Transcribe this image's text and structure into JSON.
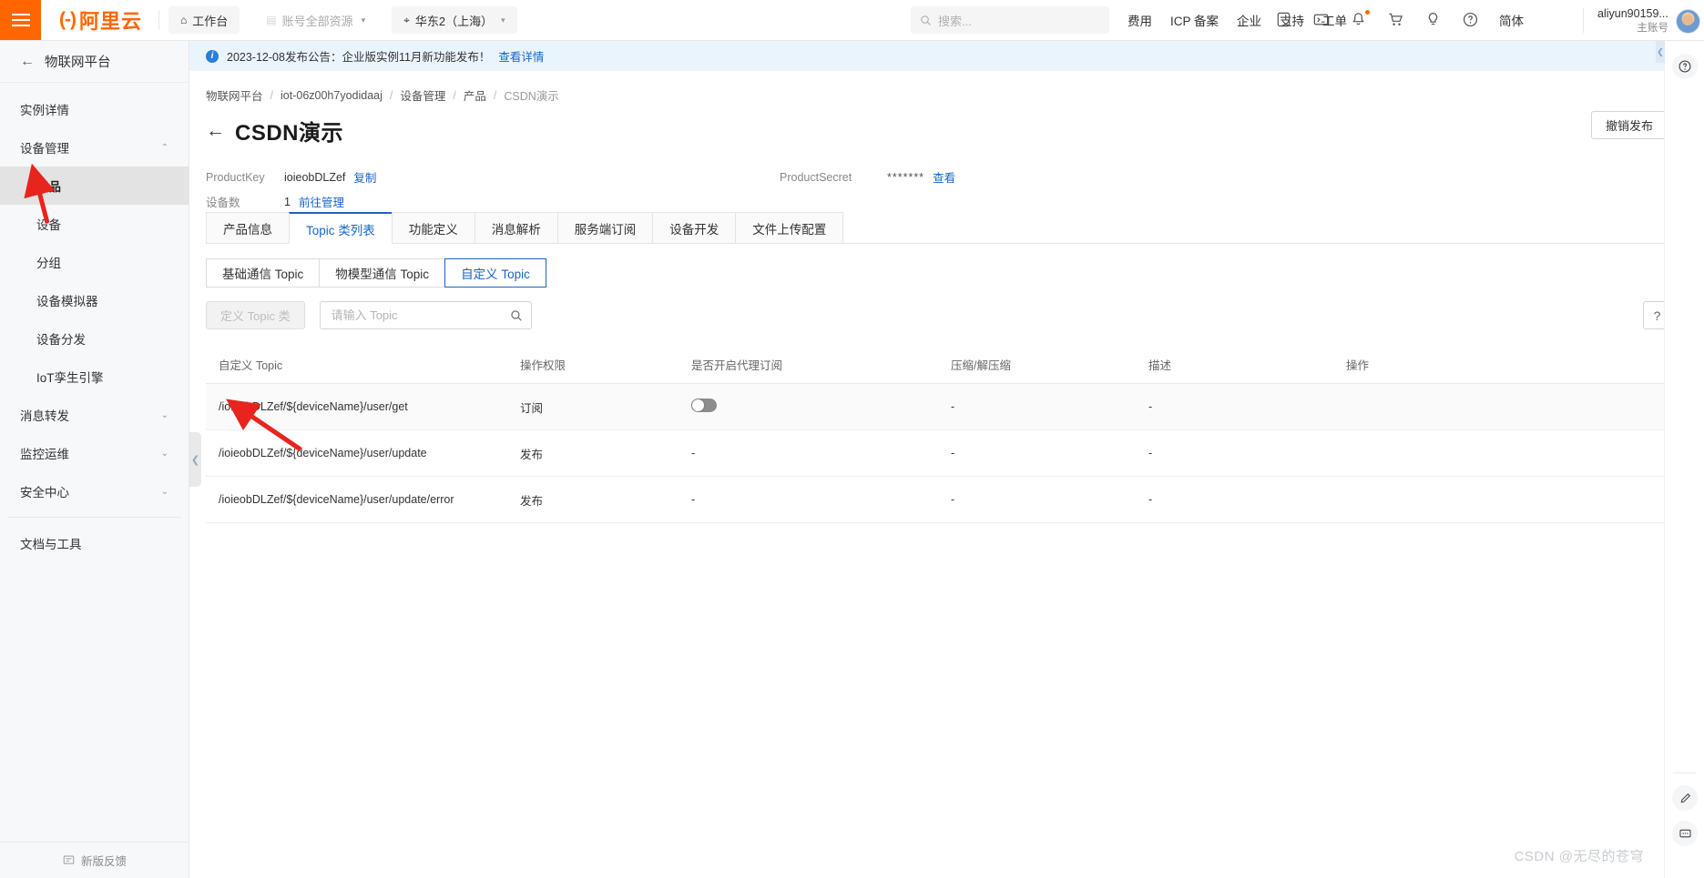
{
  "header": {
    "brand_mark": "(-)",
    "brand_text": "阿里云",
    "workbench": "工作台",
    "resource_scope": "账号全部资源",
    "region": "华东2（上海）",
    "search_placeholder": "搜索...",
    "links": [
      "费用",
      "ICP 备案",
      "企业",
      "支持",
      "工单"
    ],
    "lang": "简体",
    "account_name": "aliyun90159...",
    "account_role": "主账号",
    "icons": [
      "app-icon",
      "terminal-icon",
      "bell-icon",
      "cart-icon",
      "bulb-icon",
      "question-icon"
    ]
  },
  "sidebar": {
    "back_label": "物联网平台",
    "items": [
      {
        "label": "实例详情",
        "type": "item"
      },
      {
        "label": "设备管理",
        "type": "group",
        "expanded": true
      },
      {
        "label": "产品",
        "type": "sub",
        "active": true
      },
      {
        "label": "设备",
        "type": "sub"
      },
      {
        "label": "分组",
        "type": "sub"
      },
      {
        "label": "设备模拟器",
        "type": "sub"
      },
      {
        "label": "设备分发",
        "type": "sub"
      },
      {
        "label": "IoT孪生引擎",
        "type": "sub"
      },
      {
        "label": "消息转发",
        "type": "group"
      },
      {
        "label": "监控运维",
        "type": "group"
      },
      {
        "label": "安全中心",
        "type": "group"
      },
      {
        "label": "文档与工具",
        "type": "item",
        "after_sep": true
      }
    ],
    "footer_label": "新版反馈"
  },
  "notice": {
    "text": "2023-12-08发布公告：企业版实例11月新功能发布！",
    "link": "查看详情"
  },
  "breadcrumb": [
    "物联网平台",
    "iot-06z00h7yodidaaj",
    "设备管理",
    "产品",
    "CSDN演示"
  ],
  "page": {
    "title": "CSDN演示",
    "unpublish_button": "撤销发布"
  },
  "meta": {
    "product_key_label": "ProductKey",
    "product_key_value": "ioieobDLZef",
    "copy_label": "复制",
    "device_count_label": "设备数",
    "device_count_value": "1",
    "goto_manage_label": "前往管理",
    "product_secret_label": "ProductSecret",
    "product_secret_value": "*******",
    "view_label": "查看"
  },
  "tabs": [
    {
      "label": "产品信息",
      "active": false
    },
    {
      "label": "Topic 类列表",
      "active": true
    },
    {
      "label": "功能定义",
      "active": false
    },
    {
      "label": "消息解析",
      "active": false
    },
    {
      "label": "服务端订阅",
      "active": false
    },
    {
      "label": "设备开发",
      "active": false
    },
    {
      "label": "文件上传配置",
      "active": false
    }
  ],
  "subtabs": [
    {
      "label": "基础通信 Topic",
      "active": false
    },
    {
      "label": "物模型通信 Topic",
      "active": false
    },
    {
      "label": "自定义 Topic",
      "active": true
    }
  ],
  "filter": {
    "define_button": "定义 Topic 类",
    "search_placeholder": "请输入 Topic",
    "search_value": "",
    "help_button": "?"
  },
  "table": {
    "columns": [
      "自定义 Topic",
      "操作权限",
      "是否开启代理订阅",
      "压缩/解压缩",
      "描述",
      "操作"
    ],
    "rows": [
      {
        "topic": "/ioieobDLZef/${deviceName}/user/get",
        "permission": "订阅",
        "proxy_sub": "switch-off",
        "compress": "-",
        "desc": "-",
        "action": ""
      },
      {
        "topic": "/ioieobDLZef/${deviceName}/user/update",
        "permission": "发布",
        "proxy_sub": "-",
        "compress": "-",
        "desc": "-",
        "action": ""
      },
      {
        "topic": "/ioieobDLZef/${deviceName}/user/update/error",
        "permission": "发布",
        "proxy_sub": "-",
        "compress": "-",
        "desc": "-",
        "action": ""
      }
    ]
  },
  "watermark": "CSDN @无尽的苍穹",
  "colors": {
    "brand_orange": "#FF6600",
    "link_blue": "#1765C7",
    "notice_bg": "#EAF4FD",
    "annotation_red": "#E8241E"
  }
}
